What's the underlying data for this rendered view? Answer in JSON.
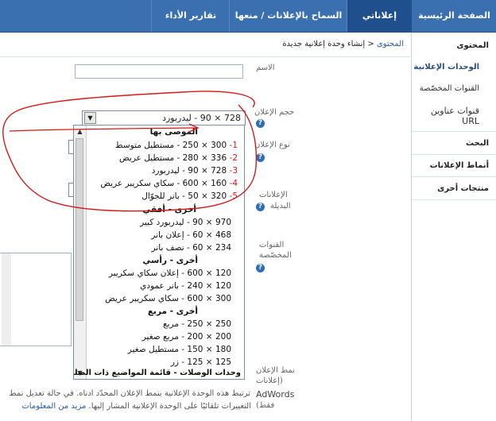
{
  "nav": {
    "tabs": [
      {
        "label": "الصفحة الرئيسية",
        "active": false
      },
      {
        "label": "إعلاناتي",
        "active": true
      },
      {
        "label": "السماح بالإعلانات / منعها",
        "active": false
      },
      {
        "label": "تقارير الأداء",
        "active": false
      }
    ]
  },
  "sidebar": {
    "section_content": "المحتوى",
    "items": [
      "الوحدات الإعلانية",
      "القنوات المخصّصة",
      "قنوات عناوين URL"
    ],
    "search": "البحث",
    "ad_styles": "أنماط الإعلانات",
    "other_products": "منتجات أخرى"
  },
  "breadcrumb": {
    "parent": "المحتوى",
    "sep": "<",
    "current": "إنشاء وحدة إعلانية جديدة"
  },
  "form": {
    "name_label": "الاسم",
    "name_value": "",
    "size_label": "حجم الإعلان",
    "size_value": "728 × 90 - ليدربورد",
    "type_label": "نوع الإعلان",
    "alt_label_1": "الإعلانات",
    "alt_label_2": "البديلة",
    "channels_label_1": "القنوات",
    "channels_label_2": "المخصّصة",
    "style_label_1": "نمط الإعلان",
    "style_label_2": "(إعلانات",
    "style_label_3": "AdWords",
    "style_label_4": "فقط)",
    "help_glyph": "?"
  },
  "dropdown": {
    "recommended_header": "الموصى بها",
    "recommended": [
      {
        "num": "1-",
        "text": "300 × 250 - مستطيل متوسط"
      },
      {
        "num": "2-",
        "text": "336 × 280 - مستطيل عريض"
      },
      {
        "num": "3-",
        "text": "728 × 90 - ليدربورد"
      },
      {
        "num": "4-",
        "text": "160 × 600 - سكاي سكريبر عريض"
      },
      {
        "num": "5-",
        "text": "320 × 50 - بانر للجوّال"
      }
    ],
    "groups": [
      {
        "header": "أخرى - أفقي",
        "items": [
          "970 × 90 - ليدربورد كبير",
          "468 × 60 - إعلان بانر",
          "234 × 60 - نصف بانر"
        ]
      },
      {
        "header": "أخرى - رأسي",
        "items": [
          "120 × 600 - إعلان سكاي سكريبر",
          "120 × 240 - بانر عمودي",
          "300 × 600 - سكاي سكريبر عريض"
        ]
      },
      {
        "header": "أخرى - مربع",
        "items": [
          "250 × 250 - مربع",
          "200 × 200 - مربع صغير",
          "180 × 150 - مستطيل صغير",
          "125 × 125 - زر"
        ]
      }
    ],
    "last_item": "وحدات الوصلات - قائمة المواضيع ذات الصلة"
  },
  "footnote": {
    "line1": "ترتبط هذه الوحدة الإعلانية بنمط الإعلان المحدّد أدناه. في حالة تعديل نمط",
    "line2": "التغييرات تلقائيًا على الوحدة الإعلانية المشار إليها.",
    "more_link": "مزيد من المعلومات"
  },
  "colors": {
    "nav_bg": "#3a6fb0",
    "nav_active": "#1f4f8c",
    "annotation_red": "#d21a1a"
  }
}
